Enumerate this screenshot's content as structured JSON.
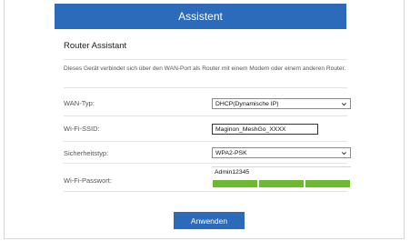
{
  "header": {
    "title": "Assistent"
  },
  "panel": {
    "title": "Router Assistant",
    "description": "Dieses Gerät verbindet sich über den WAN-Port als Router mit einem Modem oder einem anderen Router."
  },
  "form": {
    "wan_type": {
      "label": "WAN-Typ:",
      "value": "DHCP(Dynamische IP)"
    },
    "ssid": {
      "label": "Wi-Fi-SSID:",
      "value": "Maginon_MeshGo_XXXX"
    },
    "security": {
      "label": "Sicherheitstyp:",
      "value": "WPA2-PSK"
    },
    "password": {
      "label": "Wi-Fi-Passwort:",
      "value": "Admin12345",
      "strength_segments_filled": 3,
      "strength_segments_total": 3
    }
  },
  "actions": {
    "apply_label": "Anwenden"
  },
  "colors": {
    "accent": "#2b6bba",
    "strength": "#6cba2f",
    "text": "#333333"
  }
}
